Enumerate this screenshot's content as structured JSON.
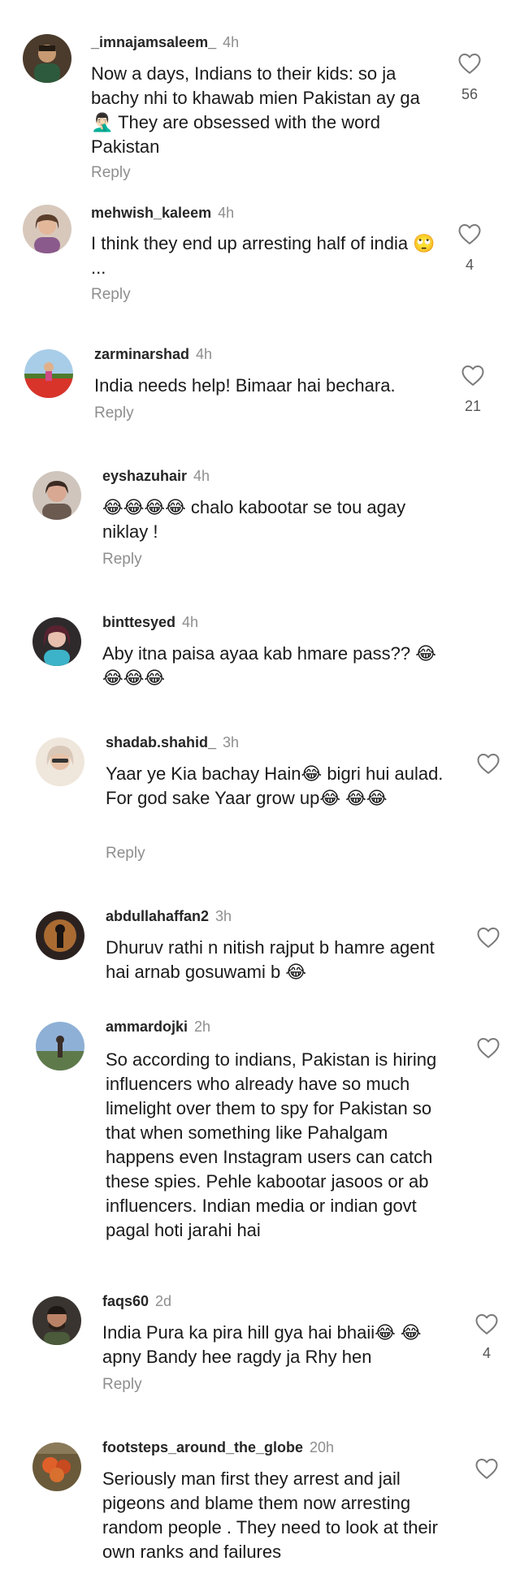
{
  "comments": [
    {
      "username": "_imnajamsaleem_",
      "time": "4h",
      "text": "Now a days, Indians to their kids: so ja bachy nhi to khawab mien Pakistan ay ga 🤦🏻‍♂️ They are obsessed with the word Pakistan",
      "reply": "Reply",
      "likes": "56"
    },
    {
      "username": "mehwish_kaleem",
      "time": "4h",
      "text": "I think they end up arresting half of india 🙄 ...",
      "reply": "Reply",
      "likes": "4"
    },
    {
      "username": "zarminarshad",
      "time": "4h",
      "text": "India needs help! Bimaar hai bechara.",
      "reply": "Reply",
      "likes": "21"
    },
    {
      "username": "eyshazuhair",
      "time": "4h",
      "text": "😂😂😂😂 chalo kabootar se tou agay niklay !",
      "reply": "Reply",
      "likes": ""
    },
    {
      "username": "binttesyed",
      "time": "4h",
      "text": "Aby itna paisa ayaa kab hmare pass?? 😂😂😂😂",
      "reply": "",
      "likes": ""
    },
    {
      "username": "shadab.shahid_",
      "time": "3h",
      "text": "Yaar ye Kia bachay Hain😂 bigri hui aulad. For god sake Yaar grow up😂 😂😂",
      "reply": "Reply",
      "likes": ""
    },
    {
      "username": "abdullahaffan2",
      "time": "3h",
      "text": "Dhuruv rathi n nitish rajput b hamre agent hai arnab gosuwami b 😂",
      "reply": "",
      "likes": ""
    },
    {
      "username": "ammardojki",
      "time": "2h",
      "text": "So according to indians, Pakistan is hiring influencers who already have so much limelight over them to spy for Pakistan so that when something like Pahalgam happens even Instagram users can catch these spies. Pehle kabootar jasoos or ab influencers. Indian media or indian govt pagal hoti jarahi hai",
      "reply": "",
      "likes": ""
    },
    {
      "username": "faqs60",
      "time": "2d",
      "text": "India Pura ka pira hill gya hai bhaii😂 😂 apny Bandy hee ragdy ja Rhy hen",
      "reply": "Reply",
      "likes": "4"
    },
    {
      "username": "footsteps_around_the_globe",
      "time": "20h",
      "text": "Seriously man first they arrest and jail pigeons and blame them now arresting random people . They need to look at their own ranks and failures",
      "reply": "",
      "likes": ""
    }
  ],
  "colors": {
    "heart_stroke": "#7a7a7a",
    "meta_time": "#8e8e8e"
  },
  "icons": {
    "like": "heart-outline-icon"
  }
}
